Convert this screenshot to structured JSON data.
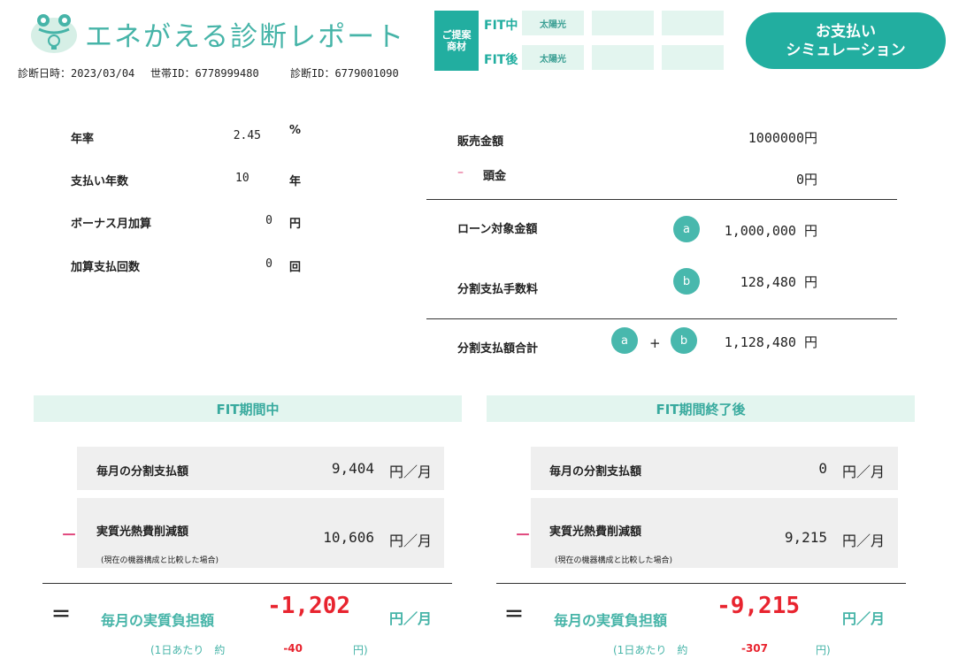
{
  "header": {
    "title": "エネがえる診断レポート",
    "diagnosis_date_label": "診断日時：",
    "diagnosis_date": "2023/03/04",
    "household_id_label": "世帯ID：",
    "household_id": "6778999480",
    "diagnosis_id_label": "診断ID：",
    "diagnosis_id": "6779001090"
  },
  "proposal": {
    "box_label_1": "ご提案",
    "box_label_2": "商材",
    "rows": [
      {
        "label": "FIT中",
        "cells": [
          "太陽光",
          "",
          ""
        ]
      },
      {
        "label": "FIT後",
        "cells": [
          "太陽光",
          "",
          ""
        ]
      }
    ]
  },
  "simulation_button": {
    "line1": "お支払い",
    "line2": "シミュレーション"
  },
  "params": [
    {
      "label": "年率",
      "value": "2.45",
      "unit": "%"
    },
    {
      "label": "支払い年数",
      "value": "10",
      "unit": "年"
    },
    {
      "label": "ボーナス月加算",
      "value": "0",
      "unit": "円"
    },
    {
      "label": "加算支払回数",
      "value": "0",
      "unit": "回"
    }
  ],
  "loan": {
    "sale_label": "販売金額",
    "sale_value": "1000000円",
    "down_minus": "–",
    "down_label": "頭金",
    "down_value": "0円",
    "loan_target_label": "ローン対象金額",
    "loan_target_value": "1,000,000 円",
    "fee_label": "分割支払手数料",
    "fee_value": "128,480 円",
    "total_label": "分割支払額合計",
    "total_value": "1,128,480 円",
    "marker_a": "a",
    "marker_b": "b",
    "plus": "+"
  },
  "fit_during": {
    "heading": "FIT期間中",
    "monthly_label": "毎月の分割支払額",
    "monthly_value": "9,404",
    "unit": "円／月",
    "minus": "－",
    "saving_label": "実質光熱費削減額",
    "saving_note": "(現在の機器構成と比較した場合)",
    "saving_value": "10,606",
    "equals": "＝",
    "result_label": "毎月の実質負担額",
    "result_value": "-1,202",
    "result_unit": "円／月",
    "perday_label": "(1日あたり　約",
    "perday_value": "-40",
    "perday_unit": "円)"
  },
  "fit_after": {
    "heading": "FIT期間終了後",
    "monthly_label": "毎月の分割支払額",
    "monthly_value": "0",
    "unit": "円／月",
    "minus": "－",
    "saving_label": "実質光熱費削減額",
    "saving_note": "(現在の機器構成と比較した場合)",
    "saving_value": "9,215",
    "equals": "＝",
    "result_label": "毎月の実質負担額",
    "result_value": "-9,215",
    "result_unit": "円／月",
    "perday_label": "(1日あたり　約",
    "perday_value": "-307",
    "perday_unit": "円)"
  },
  "colors": {
    "accent": "#22aea0",
    "accent_light": "#e3f5ef",
    "negative": "#e8242f",
    "minus_mark": "#e0447a"
  }
}
